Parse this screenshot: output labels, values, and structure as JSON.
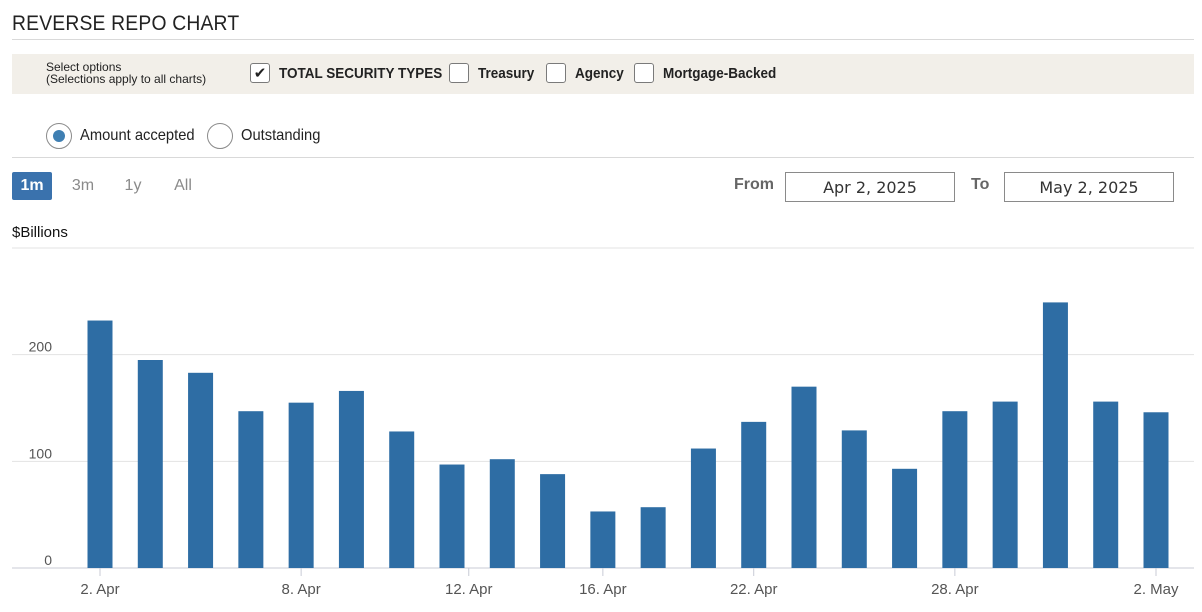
{
  "header": {
    "title": "REVERSE REPO CHART"
  },
  "options": {
    "help_line1": "Select options",
    "help_line2": "(Selections apply to all charts)",
    "checkboxes": [
      {
        "label": "TOTAL SECURITY TYPES",
        "checked": true,
        "check_glyph": "✔"
      },
      {
        "label": "Treasury",
        "checked": false,
        "check_glyph": ""
      },
      {
        "label": "Agency",
        "checked": false,
        "check_glyph": ""
      },
      {
        "label": "Mortgage-Backed",
        "checked": false,
        "check_glyph": ""
      }
    ]
  },
  "radios": [
    {
      "label": "Amount accepted",
      "selected": true
    },
    {
      "label": "Outstanding",
      "selected": false
    }
  ],
  "range_buttons": [
    {
      "label": "1m",
      "active": true
    },
    {
      "label": "3m",
      "active": false
    },
    {
      "label": "1y",
      "active": false
    },
    {
      "label": "All",
      "active": false
    }
  ],
  "date_range": {
    "from_label": "From",
    "from_value": "Apr 2, 2025",
    "to_label": "To",
    "to_value": "May 2, 2025"
  },
  "colors": {
    "bar": "#2e6da4",
    "grid": "#e3e3e3",
    "accent": "#3a72ad"
  },
  "chart_data": {
    "type": "bar",
    "ylabel": "$Billions",
    "ylim": [
      0,
      300
    ],
    "yticks": [
      0,
      100,
      200
    ],
    "grid": true,
    "categories": [
      "2025-04-02",
      "2025-04-03",
      "2025-04-04",
      "2025-04-07",
      "2025-04-08",
      "2025-04-09",
      "2025-04-10",
      "2025-04-11",
      "2025-04-14",
      "2025-04-15",
      "2025-04-16",
      "2025-04-17",
      "2025-04-21",
      "2025-04-22",
      "2025-04-23",
      "2025-04-24",
      "2025-04-25",
      "2025-04-28",
      "2025-04-29",
      "2025-04-30",
      "2025-05-01",
      "2025-05-02"
    ],
    "values": [
      232,
      195,
      183,
      147,
      155,
      166,
      128,
      97,
      102,
      88,
      53,
      57,
      112,
      137,
      170,
      129,
      93,
      147,
      156,
      249,
      156,
      146
    ],
    "xtick_labels": [
      {
        "label": "2. Apr",
        "category": "2025-04-02"
      },
      {
        "label": "8. Apr",
        "category": "2025-04-08"
      },
      {
        "label": "12. Apr",
        "category": "2025-04-12"
      },
      {
        "label": "16. Apr",
        "category": "2025-04-16"
      },
      {
        "label": "22. Apr",
        "category": "2025-04-22"
      },
      {
        "label": "28. Apr",
        "category": "2025-04-28"
      },
      {
        "label": "2. May",
        "category": "2025-05-02"
      }
    ]
  }
}
